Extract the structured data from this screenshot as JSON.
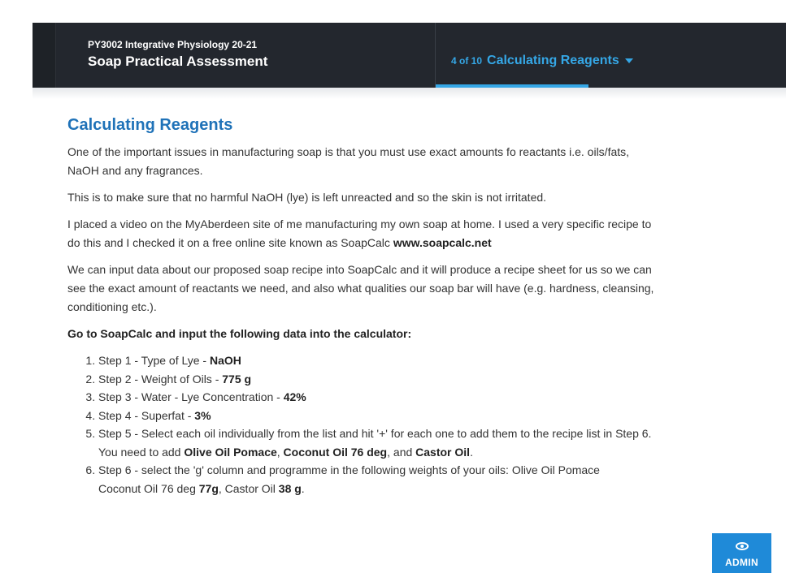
{
  "header": {
    "course_title": "PY3002 Integrative Physiology 20-21",
    "module_title": "Soap Practical Assessment",
    "page_count": "4 of 10",
    "section_title": "Calculating Reagents"
  },
  "content": {
    "heading": "Calculating Reagents",
    "para1_line1": "One of the important issues in manufacturing soap is that you must use exact amounts fo reactants i.e. oils/fats,",
    "para1_line2": "NaOH and any fragrances.",
    "para2": "This is to make sure that no harmful NaOH (lye) is left unreacted and so the skin is not irritated.",
    "para3_line1": "I placed a video on the MyAberdeen site of me manufacturing my own soap at home. I used a very specific recipe to",
    "para3_line2": "do this and I checked it on a free online site known as SoapCalc ",
    "para3_link": "www.soapcalc.net",
    "para4_line1": "We can input data about our proposed soap recipe into SoapCalc and it will produce a recipe sheet for us so we can",
    "para4_line2": "see the exact amount of reactants we need, and also what qualities our soap bar will have (e.g. hardness, cleansing,",
    "para4_line3": "conditioning etc.).",
    "instruction": "Go to SoapCalc and input the following data into the calculator:",
    "steps": [
      {
        "text": "Step 1 - Type of Lye - ",
        "bold": "NaOH"
      },
      {
        "text": "Step 2 - Weight of Oils - ",
        "bold": "775 g"
      },
      {
        "text": "Step 3 - Water - Lye Concentration - ",
        "bold": "42%"
      },
      {
        "text": "Step 4 - Superfat - ",
        "bold": "3%"
      },
      {
        "line1": "Step 5 - Select each oil individually from the list and hit '+' for each one to add them to the recipe list in Step 6.",
        "line2_a": "You need to add ",
        "oil1": "Olive Oil Pomace",
        "sep1": ", ",
        "oil2": "Coconut Oil 76 deg",
        "sep2": ", and ",
        "oil3": "Castor Oil",
        "end": "."
      },
      {
        "line1": "Step 6 - select the 'g' column and programme in the following weights of your oils: Olive Oil Pomace",
        "line2_a": "Coconut Oil 76 deg ",
        "w2": "77g",
        "sep": ", Castor Oil ",
        "w3": "38 g",
        "end": "."
      }
    ]
  },
  "admin_button": {
    "label": "ADMIN",
    "icon": "eye-icon"
  },
  "colors": {
    "header_bg": "#23272e",
    "accent": "#35a7e6",
    "heading": "#1f72b8",
    "admin_bg": "#1f8ad8"
  }
}
